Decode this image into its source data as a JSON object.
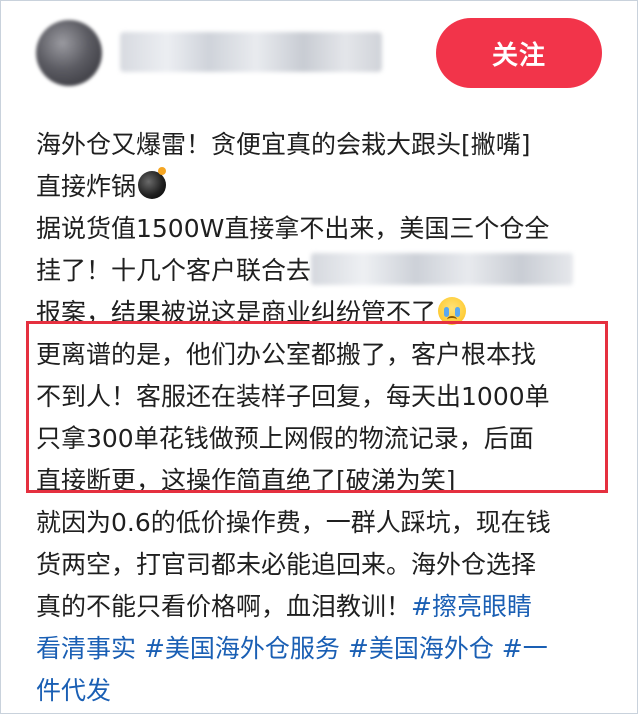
{
  "header": {
    "follow_label": "关注"
  },
  "post": {
    "lines": [
      "海外仓又爆雷！贪便宜真的会栽大跟头[撇嘴]",
      "直接炸锅",
      "据说货值1500W直接拿不出来，美国三个仓全",
      "挂了！十几个客户联合去",
      "报案，结果被说这是商业纠纷管不了",
      "更离谱的是，他们办公室都搬了，客户根本找",
      "不到人！客服还在装样子回复，每天出1000单",
      "只拿300单花钱做预上网假的物流记录，后面",
      "直接断更，这操作简直绝了[破涕为笑]",
      "就因为0.6的低价操作费，一群人踩坑，现在钱",
      "货两空，打官司都未必能追回来。海外仓选择",
      "真的不能只看价格啊，血泪教训！"
    ],
    "tags": {
      "t1a": "#擦亮眼睛",
      "t1b": "看清事实",
      "t2": "#美国海外仓服务",
      "t3": "#美国海外仓",
      "t4a": "#一",
      "t4b": "件代发"
    },
    "emojis": {
      "bomb": "bomb-emoji",
      "cry": "crying-face-emoji"
    }
  },
  "colors": {
    "follow_button": "#f2344a",
    "highlight_border": "#e5303f",
    "hashtag": "#1a5fb4"
  }
}
